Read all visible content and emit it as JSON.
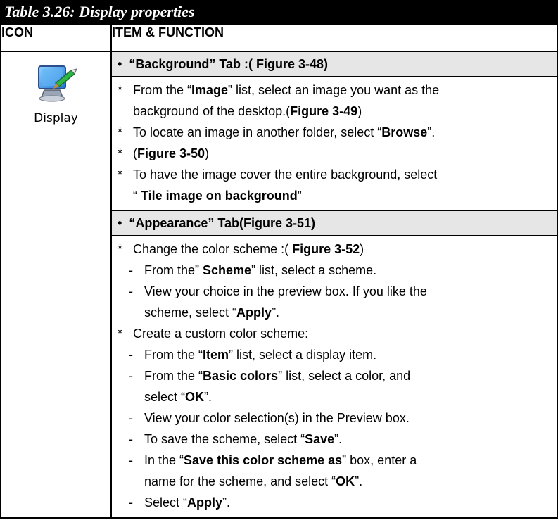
{
  "title": "Table 3.26: Display properties",
  "headers": {
    "icon": "ICON",
    "item": "ITEM & FUNCTION"
  },
  "icon": {
    "name": "display-icon",
    "label": "Display"
  },
  "markers": {
    "bullet": "•",
    "star": "*",
    "dash": "-"
  },
  "background": {
    "heading": "“Background” Tab :( Figure 3-48)",
    "l1a": "From the “",
    "l1b": "Image",
    "l1c": "” list, select an image you want as the",
    "l1d": "background of the desktop.(",
    "l1e": "Figure 3-49",
    "l1f": ")",
    "l2a": "To locate an image in another folder, select “",
    "l2b": "Browse",
    "l2c": "”.",
    "l3a": "(",
    "l3b": "Figure 3-50",
    "l3c": ")",
    "l4a": "To have the image cover the entire background, select",
    "l4b": "“ ",
    "l4c": "Tile image on background",
    "l4d": "”"
  },
  "appearance": {
    "heading": "“Appearance” Tab(Figure 3-51)",
    "a1a": "Change the color scheme :( ",
    "a1b": "Figure 3-52",
    "a1c": ")",
    "a2a": "From the” ",
    "a2b": "Scheme",
    "a2c": "” list, select a scheme.",
    "a3a": "View your choice in the preview box. If you like the",
    "a3b": "scheme, select “",
    "a3c": "Apply",
    "a3d": "”.",
    "a4": "Create a custom color scheme:",
    "a5a": "From the “",
    "a5b": "Item",
    "a5c": "” list, select a display item.",
    "a6a": "From the “",
    "a6b": "Basic colors",
    "a6c": "” list, select a color, and",
    "a6d": "select “",
    "a6e": "OK",
    "a6f": "”.",
    "a7": "View your color selection(s) in the Preview box.",
    "a8a": "To save the scheme, select “",
    "a8b": "Save",
    "a8c": "”.",
    "a9a": "In the “",
    "a9b": "Save this color scheme as",
    "a9c": "” box, enter a",
    "a9d": "name for the scheme, and select “",
    "a9e": "OK",
    "a9f": "”.",
    "a10a": "Select “",
    "a10b": "Apply",
    "a10c": "”."
  }
}
